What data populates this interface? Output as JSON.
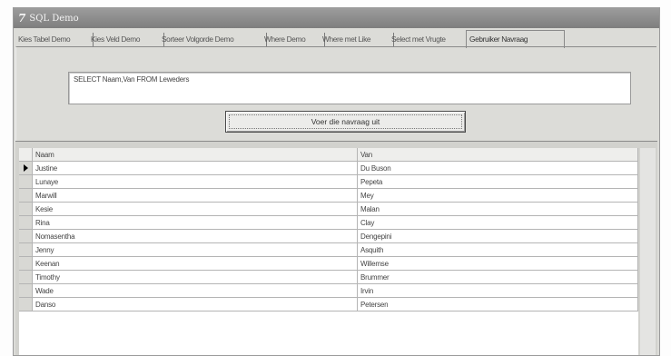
{
  "window": {
    "icon_label": "7",
    "title": "SQL Demo"
  },
  "tabs": [
    "Kies Tabel Demo",
    "Kies Veld Demo",
    "Sorteer Volgorde Demo",
    "Where Demo",
    "Where met Like",
    "Select met Vrugte",
    "Gebruiker Navraag"
  ],
  "active_tab": "Gebruiker Navraag",
  "query": {
    "text": "SELECT Naam,Van FROM Leweders"
  },
  "run_button": {
    "label": "Voer die navraag uit"
  },
  "grid": {
    "columns": [
      "Naam",
      "Van"
    ],
    "rows": [
      [
        "Justine",
        "Du Buson"
      ],
      [
        "Lunaye",
        "Pepeta"
      ],
      [
        "Marwill",
        "Mey"
      ],
      [
        "Kesie",
        "Malan"
      ],
      [
        "Rina",
        "Clay"
      ],
      [
        "Nomasentha",
        "Dengepini"
      ],
      [
        "Jenny",
        "Asquith"
      ],
      [
        "Keenan",
        "Willemse"
      ],
      [
        "Timothy",
        "Brummer"
      ],
      [
        "Wade",
        "Irvin"
      ],
      [
        "Danso",
        "Petersen"
      ]
    ],
    "current_row": 0
  }
}
